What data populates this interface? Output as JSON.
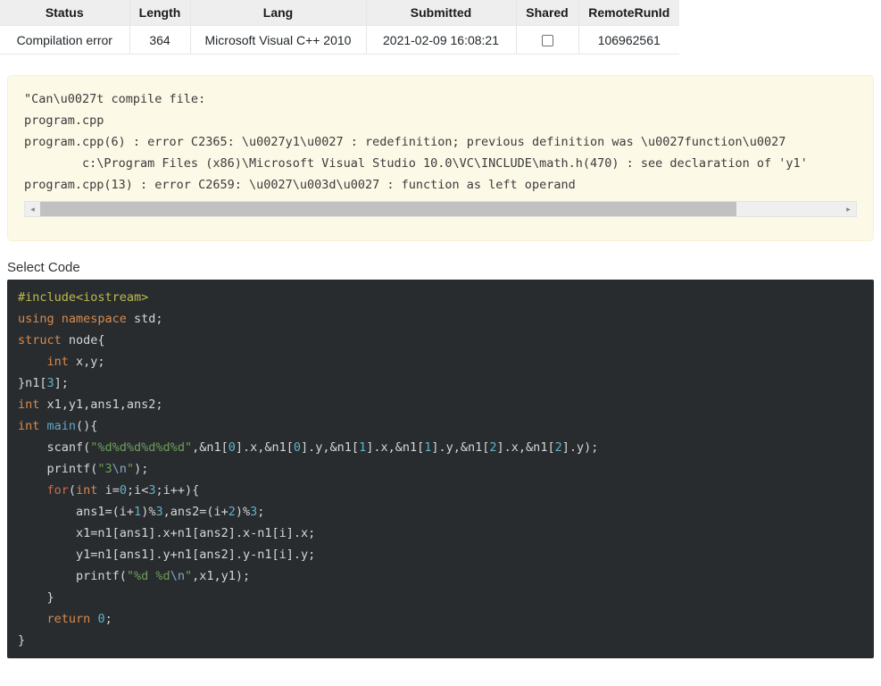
{
  "submission_table": {
    "headers": [
      "Status",
      "Length",
      "Lang",
      "Submitted",
      "Shared",
      "RemoteRunId"
    ],
    "row": {
      "status": "Compilation error",
      "length": "364",
      "lang": "Microsoft Visual C++ 2010",
      "submitted": "2021-02-09 16:08:21",
      "shared_checked": false,
      "remote_run_id": "106962561"
    },
    "status_color": "#e8685d"
  },
  "compile_error": {
    "background_color": "#fdf9e7",
    "lines": [
      "\"Can\\u0027t compile file:",
      "program.cpp",
      "program.cpp(6) : error C2365: \\u0027y1\\u0027 : redefinition; previous definition was \\u0027function\\u0027",
      "        c:\\Program Files (x86)\\Microsoft Visual Studio 10.0\\VC\\INCLUDE\\math.h(470) : see declaration of 'y1'",
      "program.cpp(13) : error C2659: \\u0027\\u003d\\u0027 : function as left operand",
      "\""
    ],
    "scrollbar": {
      "left_arrow": "◂",
      "right_arrow": "▸",
      "thumb_percent": 87
    }
  },
  "select_code": {
    "label": "Select Code",
    "background_color": "#282c2f",
    "lines": [
      [
        {
          "t": "#include<iostream>",
          "c": "tok-pre"
        }
      ],
      [
        {
          "t": "using namespace",
          "c": "tok-kw"
        },
        {
          "t": " std;",
          "c": "tok-plain"
        }
      ],
      [
        {
          "t": "struct",
          "c": "tok-kw"
        },
        {
          "t": " node{",
          "c": "tok-plain"
        }
      ],
      [
        {
          "t": "    ",
          "c": "tok-plain"
        },
        {
          "t": "int",
          "c": "tok-kw"
        },
        {
          "t": " x,y;",
          "c": "tok-plain"
        }
      ],
      [
        {
          "t": "}n1[",
          "c": "tok-plain"
        },
        {
          "t": "3",
          "c": "tok-num"
        },
        {
          "t": "];",
          "c": "tok-plain"
        }
      ],
      [
        {
          "t": "int",
          "c": "tok-kw"
        },
        {
          "t": " x1,y1,ans1,ans2;",
          "c": "tok-plain"
        }
      ],
      [
        {
          "t": "int",
          "c": "tok-kw"
        },
        {
          "t": " ",
          "c": "tok-plain"
        },
        {
          "t": "main",
          "c": "tok-fn"
        },
        {
          "t": "(){",
          "c": "tok-plain"
        }
      ],
      [
        {
          "t": "    scanf(",
          "c": "tok-plain"
        },
        {
          "t": "\"%d%d%d%d%d%d\"",
          "c": "tok-str"
        },
        {
          "t": ",&n1[",
          "c": "tok-plain"
        },
        {
          "t": "0",
          "c": "tok-num"
        },
        {
          "t": "].x,&n1[",
          "c": "tok-plain"
        },
        {
          "t": "0",
          "c": "tok-num"
        },
        {
          "t": "].y,&n1[",
          "c": "tok-plain"
        },
        {
          "t": "1",
          "c": "tok-num"
        },
        {
          "t": "].x,&n1[",
          "c": "tok-plain"
        },
        {
          "t": "1",
          "c": "tok-num"
        },
        {
          "t": "].y,&n1[",
          "c": "tok-plain"
        },
        {
          "t": "2",
          "c": "tok-num"
        },
        {
          "t": "].x,&n1[",
          "c": "tok-plain"
        },
        {
          "t": "2",
          "c": "tok-num"
        },
        {
          "t": "].y);",
          "c": "tok-plain"
        }
      ],
      [
        {
          "t": "    printf(",
          "c": "tok-plain"
        },
        {
          "t": "\"3",
          "c": "tok-str"
        },
        {
          "t": "\\n",
          "c": "tok-esc"
        },
        {
          "t": "\"",
          "c": "tok-str"
        },
        {
          "t": ");",
          "c": "tok-plain"
        }
      ],
      [
        {
          "t": "    ",
          "c": "tok-plain"
        },
        {
          "t": "for",
          "c": "tok-kw2"
        },
        {
          "t": "(",
          "c": "tok-plain"
        },
        {
          "t": "int",
          "c": "tok-kw"
        },
        {
          "t": " i=",
          "c": "tok-plain"
        },
        {
          "t": "0",
          "c": "tok-num"
        },
        {
          "t": ";i<",
          "c": "tok-plain"
        },
        {
          "t": "3",
          "c": "tok-num"
        },
        {
          "t": ";i++){",
          "c": "tok-plain"
        }
      ],
      [
        {
          "t": "        ans1=(i+",
          "c": "tok-plain"
        },
        {
          "t": "1",
          "c": "tok-num"
        },
        {
          "t": ")%",
          "c": "tok-plain"
        },
        {
          "t": "3",
          "c": "tok-num"
        },
        {
          "t": ",ans2=(i+",
          "c": "tok-plain"
        },
        {
          "t": "2",
          "c": "tok-num"
        },
        {
          "t": ")%",
          "c": "tok-plain"
        },
        {
          "t": "3",
          "c": "tok-num"
        },
        {
          "t": ";",
          "c": "tok-plain"
        }
      ],
      [
        {
          "t": "        x1=n1[ans1].x+n1[ans2].x-n1[i].x;",
          "c": "tok-plain"
        }
      ],
      [
        {
          "t": "        y1=n1[ans1].y+n1[ans2].y-n1[i].y;",
          "c": "tok-plain"
        }
      ],
      [
        {
          "t": "        printf(",
          "c": "tok-plain"
        },
        {
          "t": "\"%d %d",
          "c": "tok-str"
        },
        {
          "t": "\\n",
          "c": "tok-esc"
        },
        {
          "t": "\"",
          "c": "tok-str"
        },
        {
          "t": ",x1,y1);",
          "c": "tok-plain"
        }
      ],
      [
        {
          "t": "    }",
          "c": "tok-plain"
        }
      ],
      [
        {
          "t": "    ",
          "c": "tok-plain"
        },
        {
          "t": "return",
          "c": "tok-kw"
        },
        {
          "t": " ",
          "c": "tok-plain"
        },
        {
          "t": "0",
          "c": "tok-num"
        },
        {
          "t": ";",
          "c": "tok-plain"
        }
      ],
      [
        {
          "t": "}",
          "c": "tok-plain"
        }
      ]
    ]
  }
}
